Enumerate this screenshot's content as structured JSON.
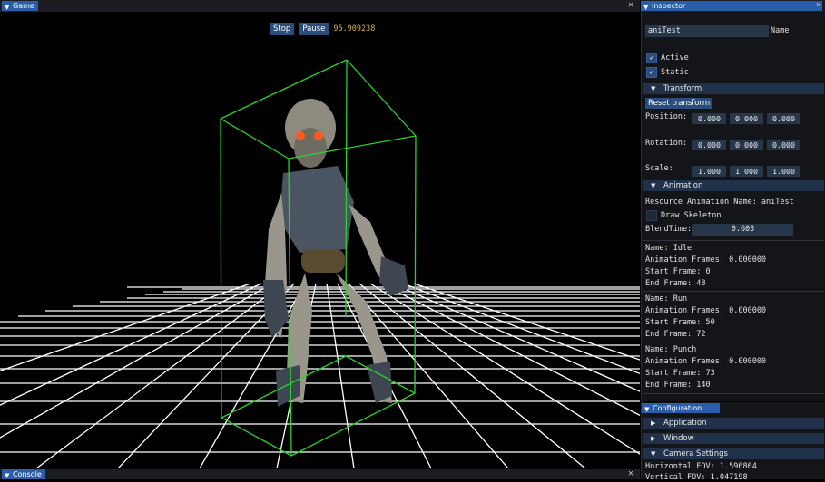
{
  "game": {
    "tab_label": "Game",
    "stop_label": "Stop",
    "pause_label": "Pause",
    "timer": "95.909238"
  },
  "inspector": {
    "tab_label": "Inspector",
    "name_value": "aniTest",
    "name_label": "Name",
    "active_label": "Active",
    "static_label": "Static",
    "transform_header": "Transform",
    "reset_label": "Reset transform",
    "position_label": "Position:",
    "position": [
      "0.000",
      "0.000",
      "0.000"
    ],
    "rotation_label": "Rotation:",
    "rotation": [
      "0.000",
      "0.000",
      "0.000"
    ],
    "scale_label": "Scale:",
    "scale": [
      "1.000",
      "1.000",
      "1.000"
    ],
    "animation_header": "Animation",
    "resource_name": "Resource Animation Name: aniTest",
    "draw_skeleton_label": "Draw Skeleton",
    "blend_label": "BlendTime:",
    "blend_value": "0.603",
    "animations": [
      {
        "name": "Name: Idle",
        "frames": "Animation Frames: 0.000000",
        "start": "Start Frame: 0",
        "end": "End Frame: 48"
      },
      {
        "name": "Name: Run",
        "frames": "Animation Frames: 0.000000",
        "start": "Start Frame: 50",
        "end": "End Frame: 72"
      },
      {
        "name": "Name: Punch",
        "frames": "Animation Frames: 0.000000",
        "start": "Start Frame: 73",
        "end": "End Frame: 140"
      }
    ]
  },
  "configuration": {
    "tab_label": "Configuration",
    "application_label": "Application",
    "window_label": "Window",
    "camera_label": "Camera Settings",
    "hfov": "Horizontal FOV: 1.596864",
    "vfov": "Vertical FOV: 1.047198"
  },
  "console": {
    "tab_label": "Console"
  },
  "colors": {
    "accent": "#2a4d7c",
    "grid": "#ffffff",
    "bbox": "#29d12e",
    "timer": "#d8b24a"
  }
}
